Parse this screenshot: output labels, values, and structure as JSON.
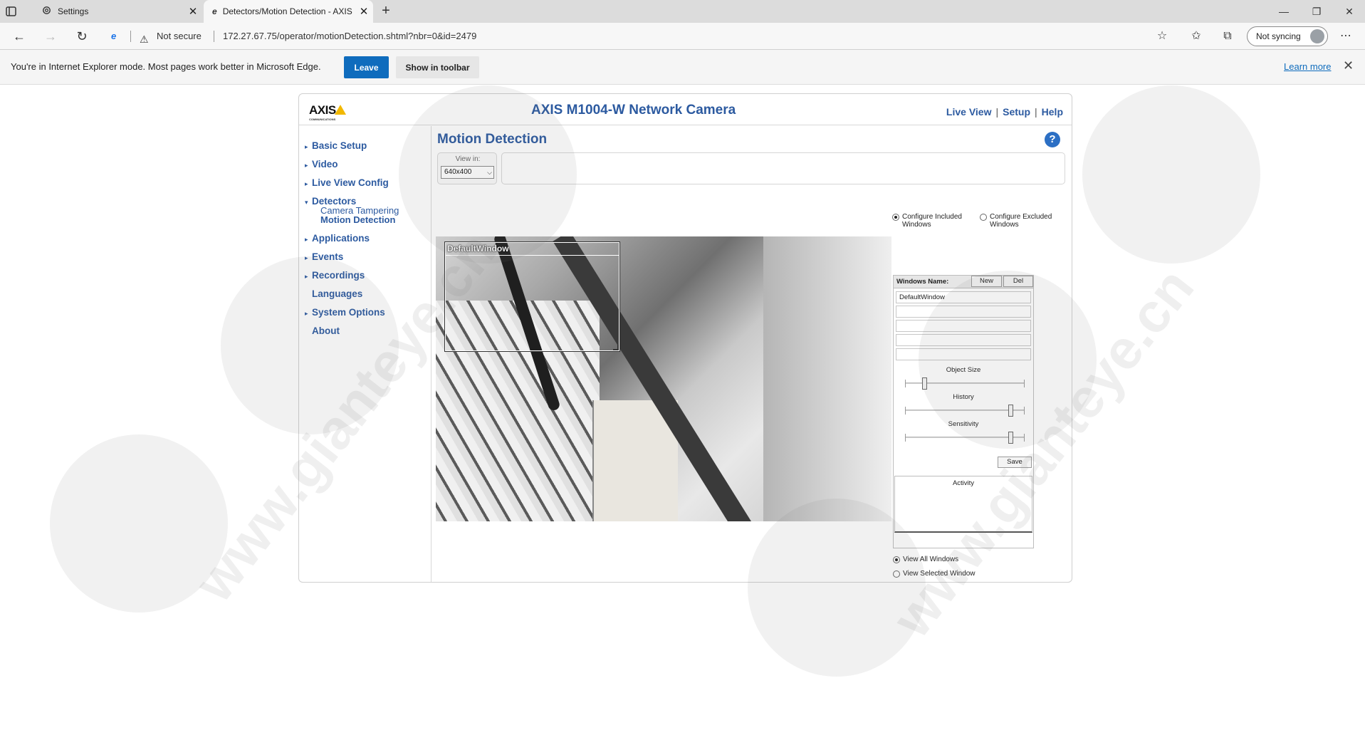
{
  "browser": {
    "tabs": [
      {
        "label": "Settings",
        "icon": "gear-icon"
      },
      {
        "label": "Detectors/Motion Detection - AXIS",
        "icon": "ie-icon"
      }
    ],
    "security_label": "Not secure",
    "url": "172.27.67.75/operator/motionDetection.shtml?nbr=0&id=2479",
    "sync_label": "Not syncing"
  },
  "ie_bar": {
    "message": "You're in Internet Explorer mode. Most pages work better in Microsoft Edge.",
    "leave_label": "Leave",
    "show_toolbar_label": "Show in toolbar",
    "learn_more_label": "Learn more"
  },
  "camera": {
    "logo": "AXIS",
    "logo_sub": "COMMUNICATIONS",
    "title": "AXIS M1004-W Network Camera",
    "top_links": [
      "Live View",
      "Setup",
      "Help"
    ]
  },
  "sidebar": {
    "items": [
      {
        "label": "Basic Setup"
      },
      {
        "label": "Video"
      },
      {
        "label": "Live View Config"
      },
      {
        "label": "Detectors",
        "subitems": [
          "Camera Tampering",
          "Motion Detection"
        ]
      },
      {
        "label": "Applications"
      },
      {
        "label": "Events"
      },
      {
        "label": "Recordings"
      },
      {
        "label": "Languages"
      },
      {
        "label": "System Options"
      },
      {
        "label": "About"
      }
    ]
  },
  "motion": {
    "title": "Motion Detection",
    "view_in_label": "View in:",
    "view_in_value": "640x400",
    "configure_included": "Configure Included Windows",
    "configure_excluded": "Configure Excluded Windows",
    "windows_name_label": "Windows Name:",
    "new_label": "New",
    "del_label": "Del",
    "windows": [
      "DefaultWindow",
      "",
      "",
      "",
      ""
    ],
    "overlay_label": "DefaultWindow",
    "object_size_label": "Object Size",
    "object_size_level": 0.15,
    "history_label": "History",
    "history_level": 0.9,
    "sensitivity_label": "Sensitivity",
    "sensitivity_level": 0.9,
    "save_label": "Save",
    "activity_label": "Activity",
    "view_all_label": "View All Windows",
    "view_selected_label": "View Selected Window"
  },
  "watermark": {
    "text": "www.gianteye.cn",
    "badge": "GIANTEYE"
  }
}
